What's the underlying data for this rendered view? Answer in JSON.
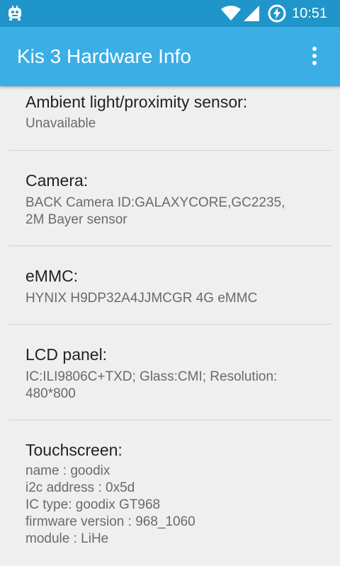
{
  "status_bar": {
    "time": "10:51"
  },
  "app_bar": {
    "title": "Kis 3 Hardware Info"
  },
  "items": [
    {
      "title": "Ambient light/proximity sensor:",
      "value": "Unavailable"
    },
    {
      "title": "Camera:",
      "value": "BACK Camera ID:GALAXYCORE,GC2235,\n2M Bayer sensor"
    },
    {
      "title": "eMMC:",
      "value": "HYNIX H9DP32A4JJMCGR 4G eMMC"
    },
    {
      "title": "LCD panel:",
      "value": "IC:ILI9806C+TXD; Glass:CMI; Resolution:\n480*800"
    },
    {
      "title": "Touchscreen:",
      "value": "name : goodix\ni2c address : 0x5d\nIC type: goodix GT968\nfirmware version : 968_1060\nmodule : LiHe"
    }
  ],
  "colors": {
    "status_bar": "#1f95c9",
    "app_bar": "#3baee6",
    "background": "#efefef"
  }
}
